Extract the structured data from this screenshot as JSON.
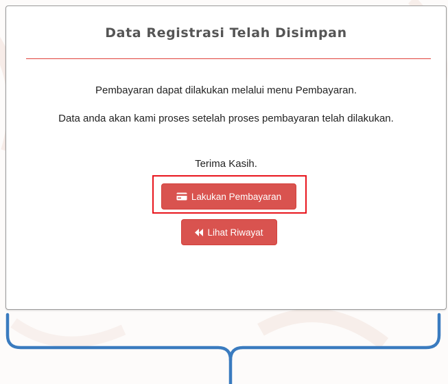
{
  "page": {
    "title": "Data Registrasi Telah Disimpan",
    "message_1": "Pembayaran dapat dilakukan melalui menu Pembayaran.",
    "message_2": "Data anda akan kami proses setelah proses pembayaran telah dilakukan.",
    "message_3": "Terima Kasih."
  },
  "buttons": {
    "pay_label": "Lakukan Pembayaran",
    "pay_icon": "credit-card-icon",
    "history_label": "Lihat Riwayat",
    "history_icon": "backward-icon"
  },
  "colors": {
    "accent": "#d9534f",
    "divider": "#e0413a",
    "highlight": "#e8141c",
    "bracket": "#3a7bbf"
  }
}
